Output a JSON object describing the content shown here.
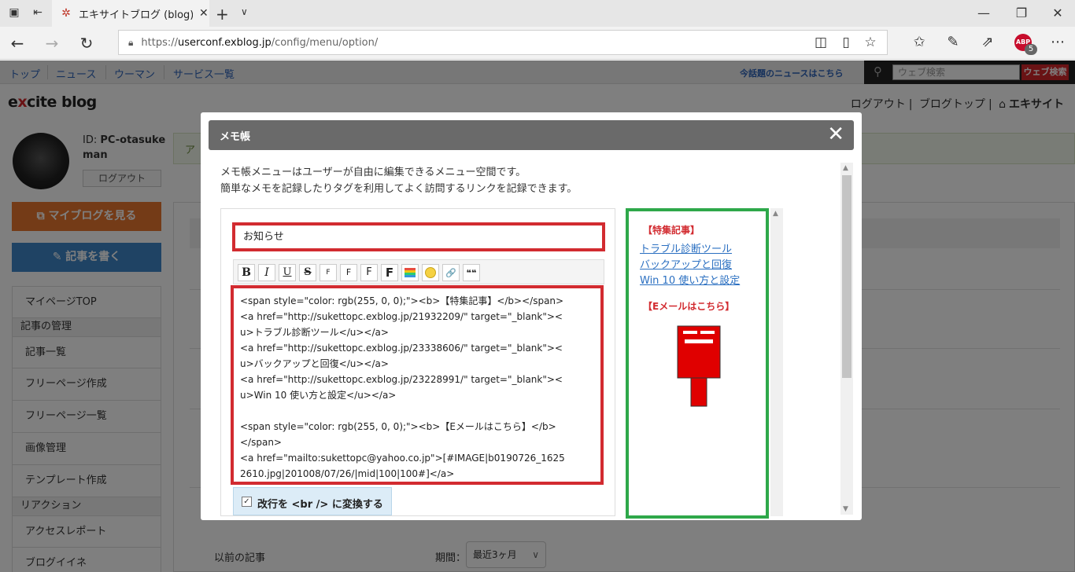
{
  "browser": {
    "tab_title": "エキサイトブログ (blog)|表示",
    "url_prefix": "https://",
    "url_domain": "userconf.exblog.jp",
    "url_path": "/config/menu/option/",
    "abp_label": "ABP",
    "abp_count": "5",
    "icons": [
      "tab-actions-icon",
      "back-tab-icon",
      "back-icon",
      "forward-icon",
      "refresh-icon",
      "lock-icon",
      "reading-view-icon",
      "favorite-star-icon",
      "favorites-hub-icon",
      "pen-icon",
      "share-icon",
      "more-icon"
    ]
  },
  "site": {
    "nav": [
      "トップ",
      "ニュース",
      "ウーマン",
      "サービス一覧"
    ],
    "news_link": "今話題のニュースはこちら",
    "search_placeholder": "ウェブ検索",
    "search_button": "ウェブ検索",
    "logo_prefix": "e",
    "logo_x": "x",
    "logo_rest": "cite blog",
    "logout_link": "ログアウト",
    "blogtop_link": "ブログトップ",
    "excite_link": "エキサイト",
    "user_id_label": "ID:",
    "user_id": "PC-otasukeman",
    "logout_button": "ログアウト",
    "my_blog_button": "マイブログを見る",
    "write_button": "記事を書く",
    "notice_text": "ア",
    "side_top": "マイページTOP",
    "side_section_articles": "記事の管理",
    "side_articles": [
      "記事一覧",
      "フリーページ作成",
      "フリーページ一覧",
      "画像管理",
      "テンプレート作成"
    ],
    "side_section_reaction": "リアクション",
    "side_reaction": [
      "アクセスレポート",
      "ブログイイネ"
    ],
    "prev_articles_label": "以前の記事",
    "period_label": "期間：",
    "period_value": "最近3ヶ月"
  },
  "modal": {
    "title": "メモ帳",
    "close": "✕",
    "description": [
      "メモ帳メニューはユーザーが自由に編集できるメニュー空間です。",
      "簡単なメモを記録したりタグを利用してよく訪問するリンクを記録できます。"
    ],
    "title_value": "お知らせ",
    "toolbar": {
      "bold": "B",
      "italic": "I",
      "underline": "U",
      "strike": "S",
      "font1": "F",
      "font2": "F",
      "font3": "F",
      "font4": "F",
      "link_icon": "🔗",
      "quote": "❝❝"
    },
    "code_lines": [
      "<span style=\"color: rgb(255, 0, 0);\"><b>【特集記事】</b></span>",
      "<a href=\"http://sukettopc.exblog.jp/21932209/\" target=\"_blank\"><",
      "u>トラブル診断ツール</u></a>",
      "<a href=\"http://sukettopc.exblog.jp/23338606/\" target=\"_blank\"><",
      "u>バックアップと回復</u></a>",
      "<a href=\"http://sukettopc.exblog.jp/23228991/\" target=\"_blank\"><",
      "u>Win 10 使い方と設定</u></a>",
      "",
      "<span style=\"color: rgb(255, 0, 0);\"><b>【Eメールはこちら】</b>",
      "</span>",
      "<a href=\"mailto:sukettopc@yahoo.co.jp\">[#IMAGE|b0190726_1625",
      "2610.jpg|201008/07/26/|mid|100|100#]</a>"
    ],
    "convert_br_label": "改行を <br /> に変換する",
    "convert_br_checked": true,
    "preview": {
      "heading1": "【特集記事】",
      "links": [
        "トラブル診断ツール",
        "バックアップと回復",
        "Win 10 使い方と設定"
      ],
      "heading2": "【Eメールはこちら】"
    },
    "colors": {
      "highlight_red": "#d22b30",
      "highlight_green": "#2ea84a",
      "link_blue": "#2a6fc1"
    }
  }
}
